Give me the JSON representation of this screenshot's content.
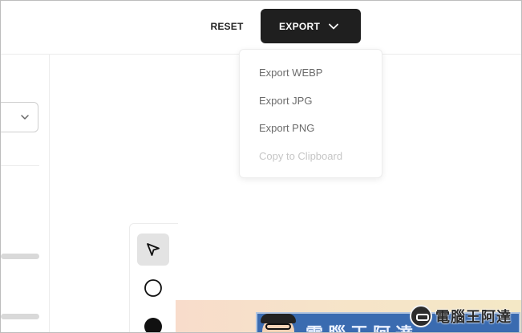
{
  "toolbar": {
    "reset_label": "RESET",
    "export_label": "EXPORT"
  },
  "export_menu": {
    "items": [
      {
        "label": "Export WEBP",
        "disabled": false
      },
      {
        "label": "Export JPG",
        "disabled": false
      },
      {
        "label": "Export PNG",
        "disabled": false
      },
      {
        "label": "Copy to Clipboard",
        "disabled": true
      }
    ]
  },
  "tools": [
    {
      "icon": "pointer-arrow-icon",
      "active": true
    },
    {
      "icon": "circle-outline-icon",
      "active": false
    },
    {
      "icon": "circle-filled-icon",
      "active": false
    }
  ],
  "canvas": {
    "thumbnail_title": "電腦王阿達"
  },
  "watermark": {
    "text": "電腦王阿達"
  },
  "colors": {
    "export_button_bg": "#1f1f1f",
    "active_tool_bg": "#e3e3e3",
    "menu_text": "#6b6b6b",
    "menu_text_disabled": "#c6c6c6"
  }
}
